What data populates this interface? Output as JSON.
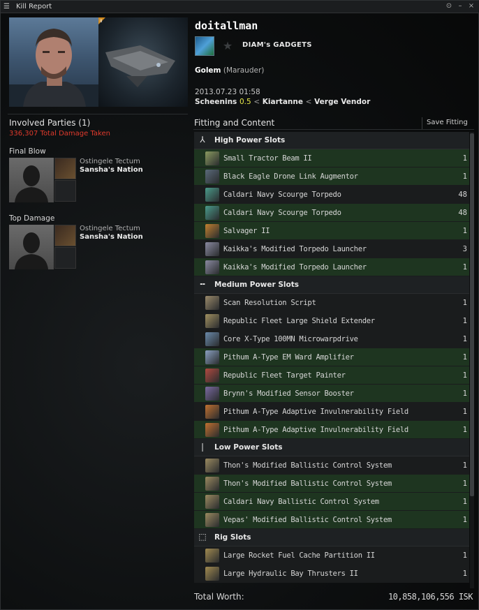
{
  "window": {
    "title": "Kill Report",
    "menu_icon": "hamburger-icon",
    "controls": [
      "info-icon",
      "minimize-icon",
      "close-icon"
    ]
  },
  "victim": {
    "name": "doitallman",
    "corporation": "DIAM's GADGETS",
    "ship": "Golem",
    "ship_class": "(Marauder)",
    "date": "2013.07.23  01:58",
    "location": {
      "system": "Scheenins",
      "security": "0.5",
      "constellation": "Kiartanne",
      "region": "Verge Vendor",
      "separator": "<"
    }
  },
  "involved": {
    "title": "Involved Parties (1)",
    "damage_taken": "336,307 Total Damage Taken",
    "final_blow_label": "Final Blow",
    "top_damage_label": "Top Damage",
    "final_blow": {
      "name": "Ostingele Tectum",
      "corp": "Sansha's Nation"
    },
    "top_damage": {
      "name": "Ostingele Tectum",
      "corp": "Sansha's Nation"
    }
  },
  "fitting": {
    "title": "Fitting and Content",
    "save_label": "Save Fitting",
    "groups": [
      {
        "title": "High Power Slots",
        "icon": "high-slot-icon",
        "items": [
          {
            "name": "Small Tractor Beam II",
            "qty": "1",
            "state": "green",
            "color": "#8a9a60"
          },
          {
            "name": "Black Eagle Drone Link Augmentor",
            "qty": "1",
            "state": "green",
            "color": "#5a6a7a"
          },
          {
            "name": "Caldari Navy Scourge Torpedo",
            "qty": "48",
            "state": "dark",
            "color": "#4a9a8a"
          },
          {
            "name": "Caldari Navy Scourge Torpedo",
            "qty": "48",
            "state": "green",
            "color": "#4a9a8a"
          },
          {
            "name": "Salvager II",
            "qty": "1",
            "state": "green",
            "color": "#c08030"
          },
          {
            "name": "Kaikka's Modified Torpedo Launcher",
            "qty": "3",
            "state": "dark",
            "color": "#8a8aa0"
          },
          {
            "name": "Kaikka's Modified Torpedo Launcher",
            "qty": "1",
            "state": "green",
            "color": "#8a8aa0"
          }
        ]
      },
      {
        "title": "Medium Power Slots",
        "icon": "mid-slot-icon",
        "items": [
          {
            "name": "Scan Resolution Script",
            "qty": "1",
            "state": "dark",
            "color": "#9a8a6a"
          },
          {
            "name": "Republic Fleet Large Shield Extender",
            "qty": "1",
            "state": "dark",
            "color": "#a09060"
          },
          {
            "name": "Core X-Type 100MN Microwarpdrive",
            "qty": "1",
            "state": "dark",
            "color": "#6a8aaa"
          },
          {
            "name": "Pithum A-Type EM Ward Amplifier",
            "qty": "1",
            "state": "green",
            "color": "#8aa0c0"
          },
          {
            "name": "Republic Fleet Target Painter",
            "qty": "1",
            "state": "green",
            "color": "#b04a40"
          },
          {
            "name": "Brynn's Modified Sensor Booster",
            "qty": "1",
            "state": "green",
            "color": "#7a6aa0"
          },
          {
            "name": "Pithum A-Type Adaptive Invulnerability Field",
            "qty": "1",
            "state": "dark",
            "color": "#c07030"
          },
          {
            "name": "Pithum A-Type Adaptive Invulnerability Field",
            "qty": "1",
            "state": "green",
            "color": "#c07030"
          }
        ]
      },
      {
        "title": "Low Power Slots",
        "icon": "low-slot-icon",
        "items": [
          {
            "name": "Thon's Modified Ballistic Control System",
            "qty": "1",
            "state": "dark",
            "color": "#9a8a60"
          },
          {
            "name": "Thon's Modified Ballistic Control System",
            "qty": "1",
            "state": "green",
            "color": "#9a8a60"
          },
          {
            "name": "Caldari Navy Ballistic Control System",
            "qty": "1",
            "state": "green",
            "color": "#9a8a60"
          },
          {
            "name": "Vepas' Modified Ballistic Control System",
            "qty": "1",
            "state": "green",
            "color": "#9a8a60"
          }
        ]
      },
      {
        "title": "Rig Slots",
        "icon": "rig-slot-icon",
        "items": [
          {
            "name": "Large Rocket Fuel Cache Partition II",
            "qty": "1",
            "state": "dark",
            "color": "#a08a50"
          },
          {
            "name": "Large Hydraulic Bay Thrusters II",
            "qty": "1",
            "state": "dark",
            "color": "#a08a50"
          }
        ]
      }
    ]
  },
  "total": {
    "label": "Total Worth:",
    "value": "10,858,106,556 ISK"
  }
}
